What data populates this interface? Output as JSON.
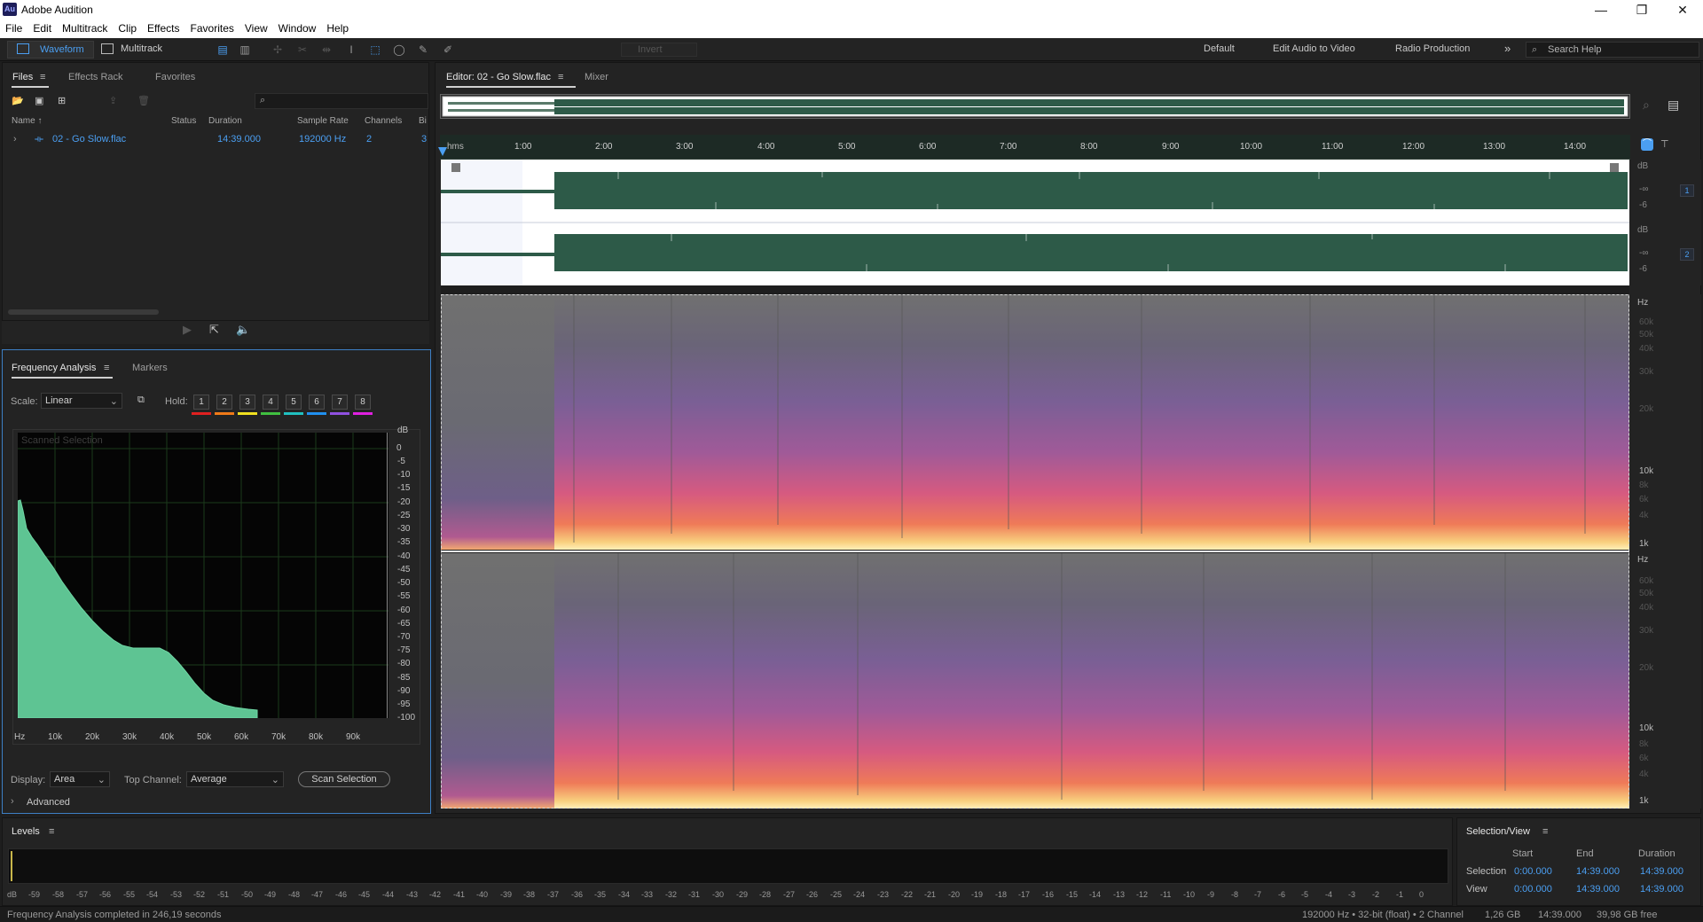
{
  "app": {
    "title": "Adobe Audition",
    "logo_text": "Au"
  },
  "window_controls": {
    "minimize": "—",
    "maximize": "❐",
    "close": "✕"
  },
  "menu": [
    "File",
    "Edit",
    "Multitrack",
    "Clip",
    "Effects",
    "Favorites",
    "View",
    "Window",
    "Help"
  ],
  "toolbar": {
    "waveform": "Waveform",
    "multitrack": "Multitrack",
    "invert": "Invert",
    "workspaces": [
      "Default",
      "Edit Audio to Video",
      "Radio Production"
    ],
    "more": "»",
    "search": "Search Help"
  },
  "files_panel": {
    "tabs": [
      "Files",
      "Effects Rack",
      "Favorites"
    ],
    "columns": [
      "Name ↑",
      "Status",
      "Duration",
      "Sample Rate",
      "Channels",
      "Bi"
    ],
    "rows": [
      {
        "name": "02 - Go Slow.flac",
        "status": "",
        "duration": "14:39.000",
        "sample_rate": "192000 Hz",
        "channels": "2",
        "bits": "3"
      }
    ]
  },
  "freq_panel": {
    "tabs": [
      "Frequency Analysis",
      "Markers"
    ],
    "scale_label": "Scale:",
    "scale_value": "Linear",
    "hold_label": "Hold:",
    "hold": [
      "1",
      "2",
      "3",
      "4",
      "5",
      "6",
      "7",
      "8"
    ],
    "hold_colors": [
      "#e02020",
      "#f07a18",
      "#f0e020",
      "#40c040",
      "#20c0c0",
      "#2090f0",
      "#9050e0",
      "#e020e0"
    ],
    "graph_title": "Scanned Selection",
    "db_unit": "dB",
    "db_ticks": [
      "0",
      "-5",
      "-10",
      "-15",
      "-20",
      "-25",
      "-30",
      "-35",
      "-40",
      "-45",
      "-50",
      "-55",
      "-60",
      "-65",
      "-70",
      "-75",
      "-80",
      "-85",
      "-90",
      "-95",
      "-100"
    ],
    "hz_ticks": [
      "Hz",
      "10k",
      "20k",
      "30k",
      "40k",
      "50k",
      "60k",
      "70k",
      "80k",
      "90k"
    ],
    "display_label": "Display:",
    "display_value": "Area",
    "top_channel_label": "Top Channel:",
    "top_channel_value": "Average",
    "scan_button": "Scan Selection",
    "advanced": "Advanced",
    "area_color": "#5ec493"
  },
  "editor": {
    "tabs": [
      "Editor: 02 - Go Slow.flac",
      "Mixer"
    ],
    "timecodes": [
      "hms",
      "1:00",
      "2:00",
      "3:00",
      "4:00",
      "5:00",
      "6:00",
      "7:00",
      "8:00",
      "9:00",
      "10:00",
      "11:00",
      "12:00",
      "13:00",
      "14:00"
    ],
    "db_labels": [
      "dB",
      "-∞",
      "-6"
    ],
    "channel_badges": [
      "1",
      "2"
    ],
    "spec_hz_labels": [
      "Hz",
      "60k",
      "50k",
      "40k",
      "30k",
      "20k",
      "10k",
      "8k",
      "6k",
      "4k",
      "1k"
    ]
  },
  "levels": {
    "title": "Levels",
    "scale": [
      "dB",
      "-59",
      "-58",
      "-57",
      "-56",
      "-55",
      "-54",
      "-53",
      "-52",
      "-51",
      "-50",
      "-49",
      "-48",
      "-47",
      "-46",
      "-45",
      "-44",
      "-43",
      "-42",
      "-41",
      "-40",
      "-39",
      "-38",
      "-37",
      "-36",
      "-35",
      "-34",
      "-33",
      "-32",
      "-31",
      "-30",
      "-29",
      "-28",
      "-27",
      "-26",
      "-25",
      "-24",
      "-23",
      "-22",
      "-21",
      "-20",
      "-19",
      "-18",
      "-17",
      "-16",
      "-15",
      "-14",
      "-13",
      "-12",
      "-11",
      "-10",
      "-9",
      "-8",
      "-7",
      "-6",
      "-5",
      "-4",
      "-3",
      "-2",
      "-1",
      "0"
    ]
  },
  "selection_view": {
    "title": "Selection/View",
    "headers": [
      "Start",
      "End",
      "Duration"
    ],
    "rows": [
      {
        "label": "Selection",
        "start": "0:00.000",
        "end": "14:39.000",
        "duration": "14:39.000"
      },
      {
        "label": "View",
        "start": "0:00.000",
        "end": "14:39.000",
        "duration": "14:39.000"
      }
    ]
  },
  "status": {
    "message": "Frequency Analysis completed in 246,19 seconds",
    "format": "192000 Hz • 32-bit (float) • 2 Channel",
    "size": "1,26 GB",
    "duration": "14:39.000",
    "free": "39,98 GB free"
  }
}
